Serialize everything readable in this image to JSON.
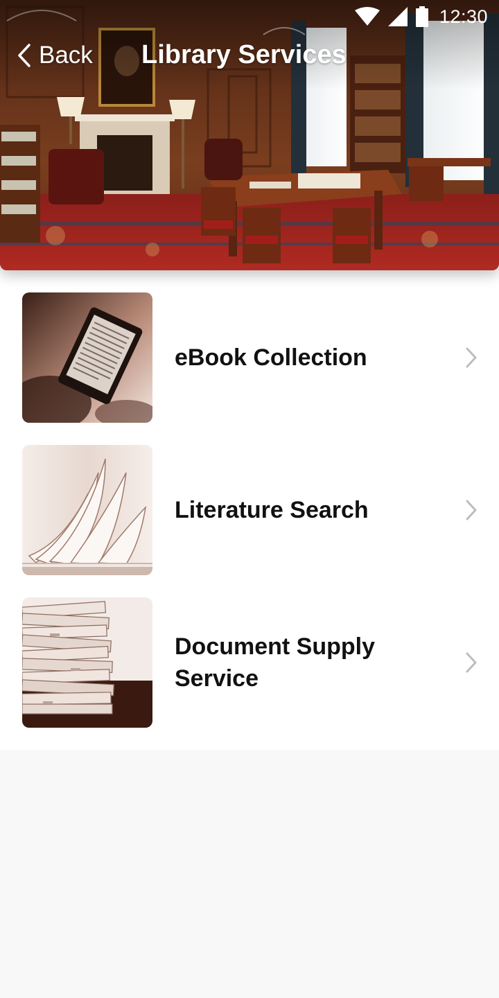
{
  "status_bar": {
    "time": "12:30",
    "icons": [
      "wifi-icon",
      "cellular-signal-icon",
      "battery-icon"
    ]
  },
  "nav": {
    "back_label": "Back",
    "back_icon": "chevron-left-icon",
    "title": "Library Services"
  },
  "services": [
    {
      "label": "eBook Collection",
      "icon": "chevron-right-icon"
    },
    {
      "label": "Literature Search",
      "icon": "chevron-right-icon"
    },
    {
      "label": "Document Supply Service",
      "icon": "chevron-right-icon"
    }
  ],
  "colors": {
    "header_text": "#ffffff",
    "item_text": "#111111",
    "chevron": "#bdbdbd",
    "list_background": "#ffffff",
    "page_background": "#f8f8f8",
    "thumbnail_tint": "#6b3b2a"
  }
}
